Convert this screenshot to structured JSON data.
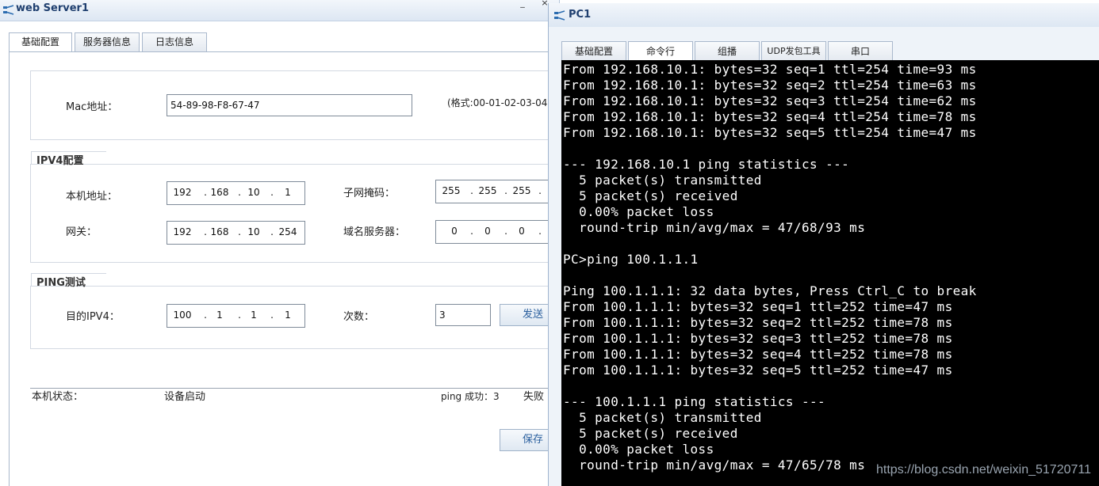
{
  "server_window": {
    "title": "web Server1",
    "controls": [
      "_",
      "×"
    ],
    "tabs": [
      {
        "label": "基础配置"
      },
      {
        "label": "服务器信息"
      },
      {
        "label": "日志信息"
      }
    ],
    "mac": {
      "label": "Mac地址：",
      "value": "54-89-98-F8-67-47",
      "hint": "(格式:00-01-02-03-04"
    },
    "ipv4": {
      "title": "IPV4配置",
      "host_label": "本机地址：",
      "host_ip": [
        "192",
        "168",
        "10",
        "1"
      ],
      "mask_label": "子网掩码：",
      "mask_ip": [
        "255",
        "255",
        "255",
        ""
      ],
      "gateway_label": "网关：",
      "gateway_ip": [
        "192",
        "168",
        "10",
        "254"
      ],
      "dns_label": "域名服务器：",
      "dns_ip": [
        "0",
        "0",
        "0",
        ""
      ]
    },
    "ping": {
      "title": "PING测试",
      "dest_label": "目的IPV4：",
      "dest_ip": [
        "100",
        "1",
        "1",
        "1"
      ],
      "count_label": "次数：",
      "count_value": "3",
      "send_label": "发送"
    },
    "status": {
      "label": "本机状态：",
      "value": "设备启动",
      "ping_success": "ping 成功：3",
      "ping_fail": "失败"
    },
    "save_label": "保存"
  },
  "pc_window": {
    "title": "PC1",
    "tabs": [
      {
        "label": "基础配置"
      },
      {
        "label": "命令行"
      },
      {
        "label": "组播"
      },
      {
        "label": "UDP发包工具"
      },
      {
        "label": "串口"
      }
    ],
    "console_lines": [
      "From 192.168.10.1: bytes=32 seq=1 ttl=254 time=93 ms",
      "From 192.168.10.1: bytes=32 seq=2 ttl=254 time=63 ms",
      "From 192.168.10.1: bytes=32 seq=3 ttl=254 time=62 ms",
      "From 192.168.10.1: bytes=32 seq=4 ttl=254 time=78 ms",
      "From 192.168.10.1: bytes=32 seq=5 ttl=254 time=47 ms",
      "",
      "--- 192.168.10.1 ping statistics ---",
      "  5 packet(s) transmitted",
      "  5 packet(s) received",
      "  0.00% packet loss",
      "  round-trip min/avg/max = 47/68/93 ms",
      "",
      "PC>ping 100.1.1.1",
      "",
      "Ping 100.1.1.1: 32 data bytes, Press Ctrl_C to break",
      "From 100.1.1.1: bytes=32 seq=1 ttl=252 time=47 ms",
      "From 100.1.1.1: bytes=32 seq=2 ttl=252 time=78 ms",
      "From 100.1.1.1: bytes=32 seq=3 ttl=252 time=78 ms",
      "From 100.1.1.1: bytes=32 seq=4 ttl=252 time=78 ms",
      "From 100.1.1.1: bytes=32 seq=5 ttl=252 time=47 ms",
      "",
      "--- 100.1.1.1 ping statistics ---",
      "  5 packet(s) transmitted",
      "  5 packet(s) received",
      "  0.00% packet loss",
      "  round-trip min/avg/max = 47/65/78 ms"
    ]
  },
  "watermark": "https://blog.csdn.net/weixin_51720711",
  "colors": {
    "console_bg": "#000000",
    "console_text": "#ffffff",
    "title_text": "#1f3f6f"
  }
}
